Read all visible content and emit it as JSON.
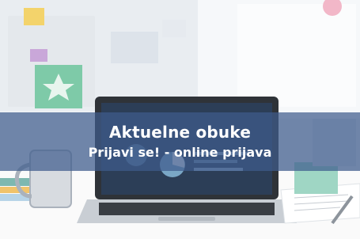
{
  "promo": {
    "title": "Aktuelne obuke",
    "subtitle": "Prijavi se! - online prijava"
  },
  "colors": {
    "banner_overlay": "#3e5c8c",
    "text": "#ffffff"
  },
  "image": {
    "subject": "laptop-on-desk-photo"
  }
}
